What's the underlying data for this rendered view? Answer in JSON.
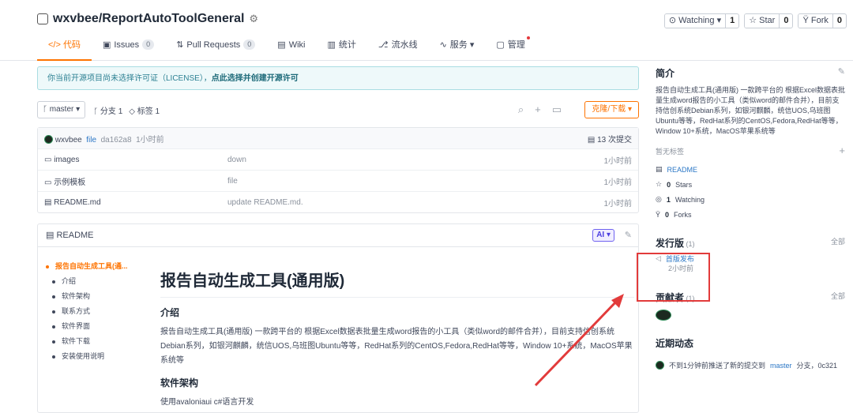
{
  "repo": {
    "title": "wxvbee/ReportAutoToolGeneral"
  },
  "header_buttons": [
    {
      "label": "⊙ Watching ▾",
      "count": "1"
    },
    {
      "label": "☆ Star",
      "count": "0"
    },
    {
      "label": "Ÿ Fork",
      "count": "0"
    }
  ],
  "tabs": [
    {
      "label": "</> 代码",
      "badge": ""
    },
    {
      "label": "Issues",
      "badge": "0"
    },
    {
      "label": "Pull Requests",
      "badge": "0"
    },
    {
      "label": "Wiki",
      "badge": ""
    },
    {
      "label": "统计",
      "badge": ""
    },
    {
      "label": "流水线",
      "badge": ""
    },
    {
      "label": "服务 ▾",
      "badge": ""
    },
    {
      "label": "管理",
      "badge": ""
    }
  ],
  "notice": {
    "text": "你当前开源项目尚未选择许可证（LICENSE），",
    "link": "点此选择并创建开源许可"
  },
  "branch": {
    "label": "master ▾",
    "branches": "分支 1",
    "tags": "标签 1",
    "clone": "克隆/下载 ▾"
  },
  "commit": {
    "author": "wxvbee",
    "msg": "file",
    "hash": "da162a8",
    "time": "1小时前",
    "count": "13 次提交"
  },
  "files": [
    {
      "name": "images",
      "msg": "down",
      "time": "1小时前"
    },
    {
      "name": "示例模板",
      "msg": "file",
      "time": "1小时前"
    },
    {
      "name": "README.md",
      "msg": "update README.md.",
      "time": "1小时前"
    }
  ],
  "readme": {
    "header": "README",
    "ai": "AI ▾",
    "toc": [
      "报告自动生成工具(通...",
      "介绍",
      "软件架构",
      "联系方式",
      "软件界面",
      "软件下载",
      "安装使用说明"
    ],
    "h1": "报告自动生成工具(通用版)",
    "h2_intro": "介绍",
    "intro": "报告自动生成工具(通用版) 一款跨平台的 根据Excel数据表批量生成word报告的小工具（类似word的邮件合并），目前支持信创系统Debian系列，如银河麒麟，统信UOS,乌班图Ubuntu等等，RedHat系列的CentOS,Fedora,RedHat等等，Window 10+系统，MacOS苹果系统等",
    "h2_arch": "软件架构",
    "arch": "使用avaloniaui c#语言开发"
  },
  "sidebar": {
    "intro_title": "简介",
    "intro_text": "报告自动生成工具(通用版) 一款跨平台的 根据Excel数据表批量生成word报告的小工具（类似word的邮件合并），目前支持信创系统Debian系列，如银河麒麟，统信UOS,乌班图Ubuntu等等，RedHat系列的CentOS,Fedora,RedHat等等，Window 10+系统，MacOS苹果系统等",
    "no_tags": "暂无标签",
    "readme": "README",
    "stars_n": "0",
    "stars": "Stars",
    "watching_n": "1",
    "watching": "Watching",
    "forks_n": "0",
    "forks": "Forks",
    "release_title": "发行版",
    "release_count": "(1)",
    "all": "全部",
    "release_name": "首版发布",
    "release_time": "2小时前",
    "contrib_title": "贡献者",
    "contrib_count": "(1)",
    "activity_title": "近期动态",
    "activity": "不到1分钟前推送了新的提交到",
    "activity_branch": "master",
    "activity_tail": "分支，0c321"
  }
}
